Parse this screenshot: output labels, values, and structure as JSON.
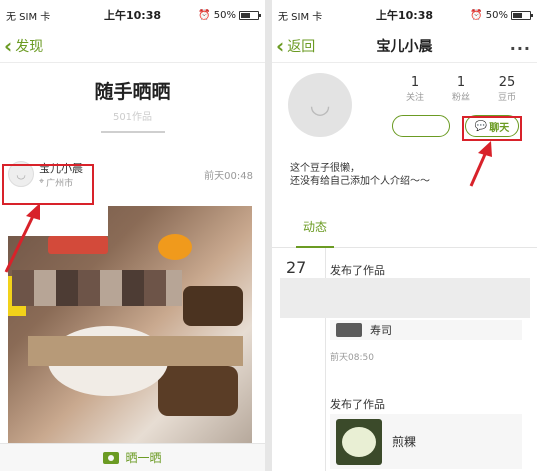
{
  "status": {
    "carrier": "无 SIM 卡",
    "time": "上午10:38",
    "battery": "50%"
  },
  "left": {
    "back_label": "发现",
    "board_title": "随手晒晒",
    "board_sub": "501作品",
    "post_user": "宝儿小晨",
    "post_location": "广州市",
    "post_time": "前天00:48",
    "bottom_action": "晒一晒"
  },
  "right": {
    "back_label": "返回",
    "title": "宝儿小晨",
    "stats": [
      {
        "value": "1",
        "label": "关注"
      },
      {
        "value": "1",
        "label": "粉丝"
      },
      {
        "value": "25",
        "label": "豆币"
      }
    ],
    "chat_label": "聊天",
    "bio_line1": "这个豆子很懒，",
    "bio_line2": "还没有给自己添加个人介绍～～",
    "tab": "动态",
    "feed": [
      {
        "day": "27",
        "action": "发布了作品",
        "dish": "寿司",
        "time": "前天08:50"
      },
      {
        "action": "发布了作品",
        "dish": "煎粿"
      }
    ]
  },
  "colors": {
    "accent": "#6b9b23",
    "annotation": "#d8222a"
  }
}
